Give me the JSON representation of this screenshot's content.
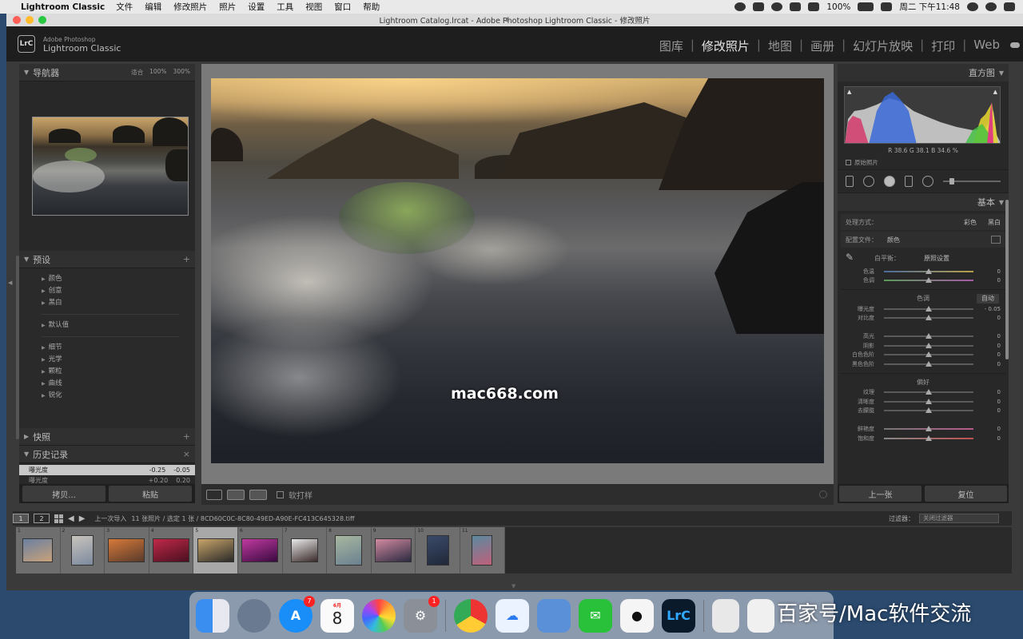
{
  "menubar": {
    "app_name": "Lightroom Classic",
    "items": [
      "文件",
      "编辑",
      "修改照片",
      "照片",
      "设置",
      "工具",
      "视图",
      "窗口",
      "帮助"
    ],
    "battery": "100%",
    "clock": "周二 下午11:48"
  },
  "window": {
    "title": "Lightroom Catalog.lrcat - Adobe Photoshop Lightroom Classic - 修改照片"
  },
  "identity": {
    "logo": "LrC",
    "brand_line1": "Adobe Photoshop",
    "brand_line2": "Lightroom Classic"
  },
  "modules": [
    {
      "label": "图库",
      "active": false
    },
    {
      "label": "修改照片",
      "active": true
    },
    {
      "label": "地图",
      "active": false
    },
    {
      "label": "画册",
      "active": false
    },
    {
      "label": "幻灯片放映",
      "active": false
    },
    {
      "label": "打印",
      "active": false
    },
    {
      "label": "Web",
      "active": false
    }
  ],
  "left": {
    "navigator": {
      "title": "导航器",
      "zoom_fit": "适合",
      "zoom_100": "100%",
      "zoom_300": "300%"
    },
    "presets": {
      "title": "预设",
      "group1": [
        "颜色",
        "创意",
        "黑白"
      ],
      "group2": [
        "默认值"
      ],
      "group3": [
        "细节",
        "光学",
        "颗粒",
        "曲线",
        "锐化"
      ]
    },
    "snapshots": {
      "title": "快照"
    },
    "history": {
      "title": "历史记录",
      "rows": [
        {
          "label": "曝光度",
          "v1": "-0.25",
          "v2": "-0.05"
        },
        {
          "label": "曝光度",
          "v1": "+0.20",
          "v2": "0.20"
        }
      ]
    },
    "copy_button": "拷贝...",
    "paste_button": "粘贴"
  },
  "center": {
    "watermark": "mac668.com",
    "soft_proof_label": "软打样"
  },
  "right": {
    "histogram": {
      "title": "直方图",
      "readout": "R  38.6  G  38.1  B  34.6 %",
      "original_label": "原始照片"
    },
    "basic": {
      "title": "基本",
      "treatment_label": "处理方式：",
      "treatment_color": "彩色",
      "treatment_bw": "黑白",
      "profile_label": "配置文件：",
      "profile_value": "颜色",
      "wb_label": "白平衡：",
      "wb_value": "原照设置",
      "tone_label": "色调",
      "auto_label": "自动",
      "presence_label": "偏好",
      "sliders_wb": [
        {
          "label": "色温",
          "value": "0",
          "track": "temp"
        },
        {
          "label": "色调",
          "value": "0",
          "track": "tint"
        }
      ],
      "sliders_tone": [
        {
          "label": "曝光度",
          "value": "- 0.05",
          "track": ""
        },
        {
          "label": "对比度",
          "value": "0",
          "track": ""
        },
        {
          "label": "",
          "value": "",
          "track": "spacer"
        },
        {
          "label": "高光",
          "value": "0",
          "track": ""
        },
        {
          "label": "阴影",
          "value": "0",
          "track": ""
        },
        {
          "label": "白色色阶",
          "value": "0",
          "track": ""
        },
        {
          "label": "黑色色阶",
          "value": "0",
          "track": ""
        }
      ],
      "sliders_presence": [
        {
          "label": "纹理",
          "value": "0",
          "track": ""
        },
        {
          "label": "清晰度",
          "value": "0",
          "track": ""
        },
        {
          "label": "去朦胧",
          "value": "0",
          "track": ""
        },
        {
          "label": "",
          "value": "",
          "track": "spacer"
        },
        {
          "label": "鲜艳度",
          "value": "0",
          "track": "vib"
        },
        {
          "label": "饱和度",
          "value": "0",
          "track": "sat"
        }
      ]
    },
    "prev_button": "上一张",
    "reset_button": "复位"
  },
  "filmbar": {
    "screen1": "1",
    "screen2": "2",
    "source": "上一次导入",
    "count": "11 张照片 / 选定 1 张 / 8CD60C0C-8C80-49ED-A90E-FC413C645328.tiff",
    "filter_label": "过滤器：",
    "filter_value": "关闭过滤器"
  },
  "filmstrip": {
    "cells": [
      {
        "num": "1",
        "colors": [
          "#6a7fa0",
          "#c9a27a"
        ],
        "w": 38,
        "h": 30
      },
      {
        "num": "2",
        "colors": [
          "#c9c4bd",
          "#7c8a9e"
        ],
        "w": 28,
        "h": 38
      },
      {
        "num": "3",
        "colors": [
          "#d67a3a",
          "#5a3a2a"
        ],
        "w": 46,
        "h": 30
      },
      {
        "num": "4",
        "colors": [
          "#c02848",
          "#4a1020"
        ],
        "w": 46,
        "h": 30
      },
      {
        "num": "5",
        "colors": [
          "#c8a46a",
          "#2a2a28"
        ],
        "w": 46,
        "h": 30,
        "selected": true
      },
      {
        "num": "6",
        "colors": [
          "#c03aa0",
          "#3a0a40"
        ],
        "w": 46,
        "h": 30
      },
      {
        "num": "7",
        "colors": [
          "#e8e8e8",
          "#3a2a2a"
        ],
        "w": 34,
        "h": 30
      },
      {
        "num": "8",
        "colors": [
          "#a8b8a0",
          "#6a8090"
        ],
        "w": 34,
        "h": 38
      },
      {
        "num": "9",
        "colors": [
          "#d28aa0",
          "#2a2a40"
        ],
        "w": 46,
        "h": 30
      },
      {
        "num": "10",
        "colors": [
          "#3a4a6a",
          "#202838"
        ],
        "w": 28,
        "h": 38
      },
      {
        "num": "11",
        "colors": [
          "#5a8aa0",
          "#c0607a"
        ],
        "w": 26,
        "h": 38
      }
    ]
  },
  "dock": {
    "appstore_badge": "7",
    "calendar_month": "6月",
    "calendar_day": "8",
    "settings_badge": "1",
    "lrc_label": "LrC"
  },
  "credit": "百家号/Mac软件交流"
}
